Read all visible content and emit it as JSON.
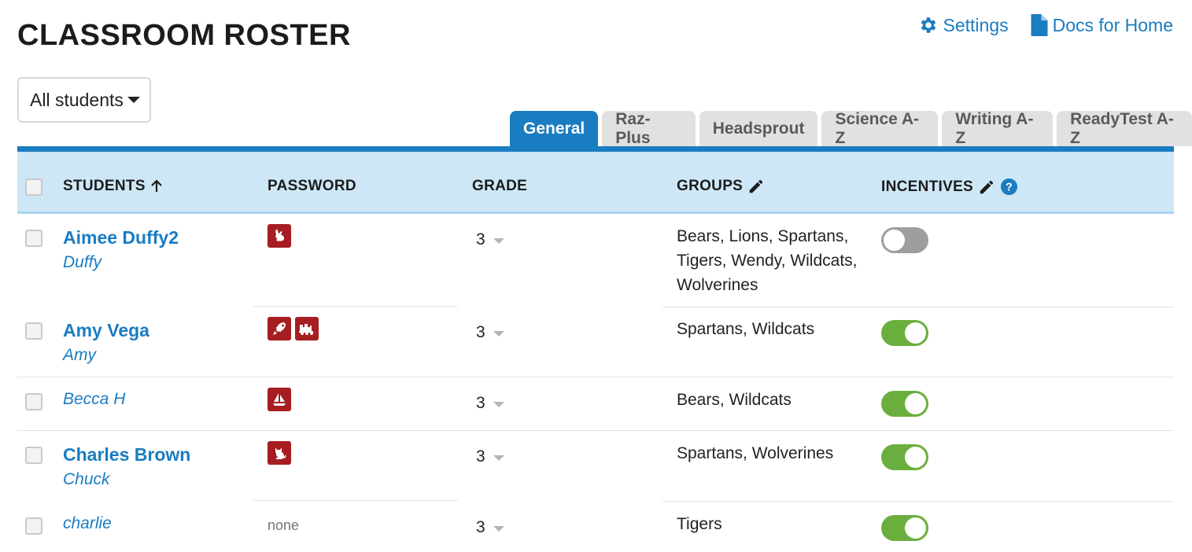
{
  "header": {
    "title": "CLASSROOM ROSTER",
    "settings_label": "Settings",
    "docs_label": "Docs for Home"
  },
  "filter": {
    "selected": "All students"
  },
  "tabs": [
    {
      "label": "General",
      "active": true
    },
    {
      "label": "Raz-Plus",
      "active": false
    },
    {
      "label": "Headsprout",
      "active": false
    },
    {
      "label": "Science A-Z",
      "active": false
    },
    {
      "label": "Writing A-Z",
      "active": false
    },
    {
      "label": "ReadyTest A-Z",
      "active": false
    }
  ],
  "columns": {
    "students": "STUDENTS",
    "password": "PASSWORD",
    "grade": "GRADE",
    "groups": "GROUPS",
    "incentives": "INCENTIVES"
  },
  "students": [
    {
      "name": "Aimee Duffy2",
      "nickname": "Duffy",
      "password_icons": [
        "rabbit-icon"
      ],
      "password_text": "",
      "grade": "3",
      "groups": "Bears, Lions, Spartans, Tigers, Wendy, Wildcats, Wolverines",
      "incentives_on": false
    },
    {
      "name": "Amy Vega",
      "nickname": "Amy",
      "password_icons": [
        "rocket-icon",
        "train-icon"
      ],
      "password_text": "",
      "grade": "3",
      "groups": "Spartans, Wildcats",
      "incentives_on": true
    },
    {
      "name": "",
      "nickname": "Becca H",
      "password_icons": [
        "sailboat-icon"
      ],
      "password_text": "",
      "grade": "3",
      "groups": "Bears, Wildcats",
      "incentives_on": true
    },
    {
      "name": "Charles Brown",
      "nickname": "Chuck",
      "password_icons": [
        "cat-icon"
      ],
      "password_text": "",
      "grade": "3",
      "groups": "Spartans, Wolverines",
      "incentives_on": true
    },
    {
      "name": "",
      "nickname": "charlie",
      "password_icons": [],
      "password_text": "none",
      "grade": "3",
      "groups": "Tigers",
      "incentives_on": true
    }
  ],
  "colors": {
    "accent": "#1a7cc1",
    "header_bg": "#cde7f6",
    "password_icon_bg": "#a61d22",
    "toggle_on": "#6aaf3d",
    "toggle_off": "#9e9e9e"
  }
}
